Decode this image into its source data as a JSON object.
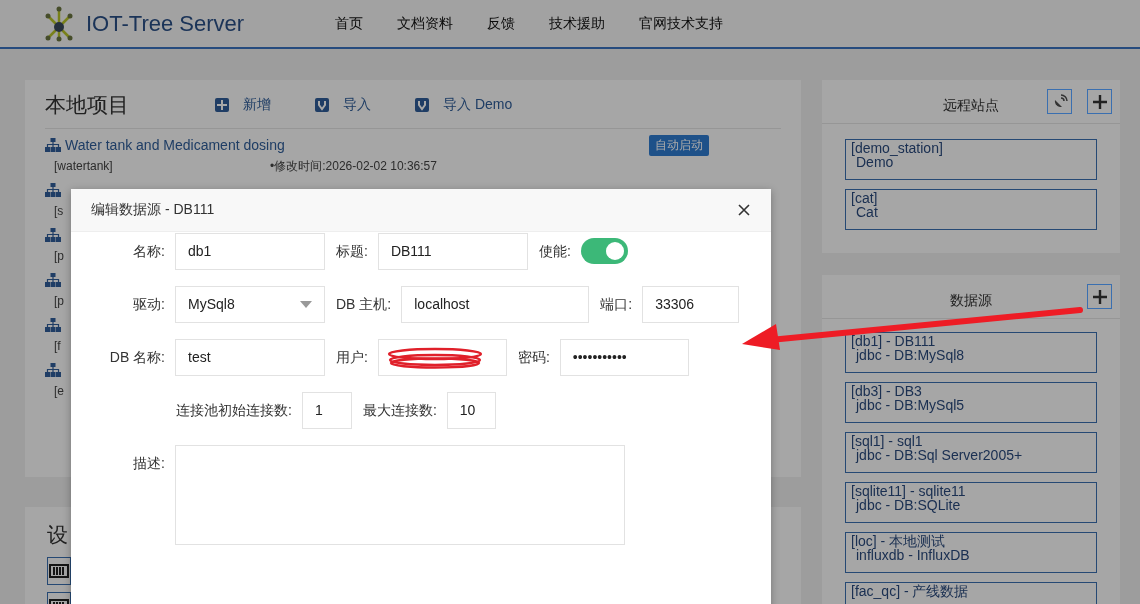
{
  "header": {
    "logo_text": "IOT-Tree Server",
    "nav": [
      {
        "label": "首页"
      },
      {
        "label": "文档资料"
      },
      {
        "label": "反馈"
      },
      {
        "label": "技术援助"
      },
      {
        "label": "官网技术支持"
      }
    ]
  },
  "projects_panel": {
    "title": "本地项目",
    "actions": [
      {
        "label": "新增",
        "kind": "add"
      },
      {
        "label": "导入",
        "kind": "import"
      },
      {
        "label": "导入 Demo",
        "kind": "import"
      }
    ],
    "projects": [
      {
        "title": "Water tank and Medicament dosing",
        "id": "[watertank]",
        "modified": "•修改时间:2026-02-02 10:36:57",
        "badge": "自动启动"
      },
      {
        "id": "[s"
      },
      {
        "id": "[p"
      },
      {
        "id": "[p"
      },
      {
        "id": "[f"
      },
      {
        "id": "[e"
      }
    ]
  },
  "devices_panel": {
    "title": "设"
  },
  "remote_stations": {
    "title": "远程站点",
    "items": [
      {
        "id": "[demo_station]",
        "name": "Demo"
      },
      {
        "id": "[cat]",
        "name": "Cat"
      }
    ]
  },
  "data_sources": {
    "title": "数据源",
    "items": [
      {
        "head": "[db1] - DB111",
        "sub": "jdbc - DB:MySql8"
      },
      {
        "head": "[db3] - DB3",
        "sub": "jdbc - DB:MySql5"
      },
      {
        "head": "[sql1] - sql1",
        "sub": "jdbc - DB:Sql Server2005+"
      },
      {
        "head": "[sqlite11] - sqlite11",
        "sub": "jdbc - DB:SQLite"
      },
      {
        "head": "[loc] - 本地测试",
        "sub": "influxdb - InfluxDB"
      },
      {
        "head": "[fac_qc] - 产线数据"
      }
    ]
  },
  "dialog": {
    "title": "编辑数据源 - DB111",
    "rows": [
      {
        "label": "名称:",
        "fields": [
          {
            "kind": "input",
            "value": "db1"
          },
          {
            "kind": "input",
            "label": "标题:",
            "value": "DB111"
          },
          {
            "kind": "toggle",
            "label": "使能:",
            "on": true
          }
        ]
      },
      {
        "label": "驱动:",
        "fields": [
          {
            "kind": "select",
            "value": "MySql8"
          },
          {
            "kind": "input",
            "label": "DB 主机:",
            "value": "localhost"
          },
          {
            "kind": "input",
            "label": "端口:",
            "value": "33306"
          }
        ]
      },
      {
        "label": "DB 名称:",
        "fields": [
          {
            "kind": "input",
            "value": "test"
          },
          {
            "kind": "redacted",
            "label": "用户:"
          },
          {
            "kind": "input",
            "label": "密码:",
            "value": "•••••••••••"
          }
        ]
      },
      {
        "fields": [
          {
            "kind": "input",
            "label": "连接池初始连接数:",
            "value": "1"
          },
          {
            "kind": "input",
            "label": "最大连接数:",
            "value": "10"
          }
        ]
      },
      {
        "label": "描述:",
        "fields": [
          {
            "kind": "textarea"
          }
        ]
      }
    ]
  }
}
